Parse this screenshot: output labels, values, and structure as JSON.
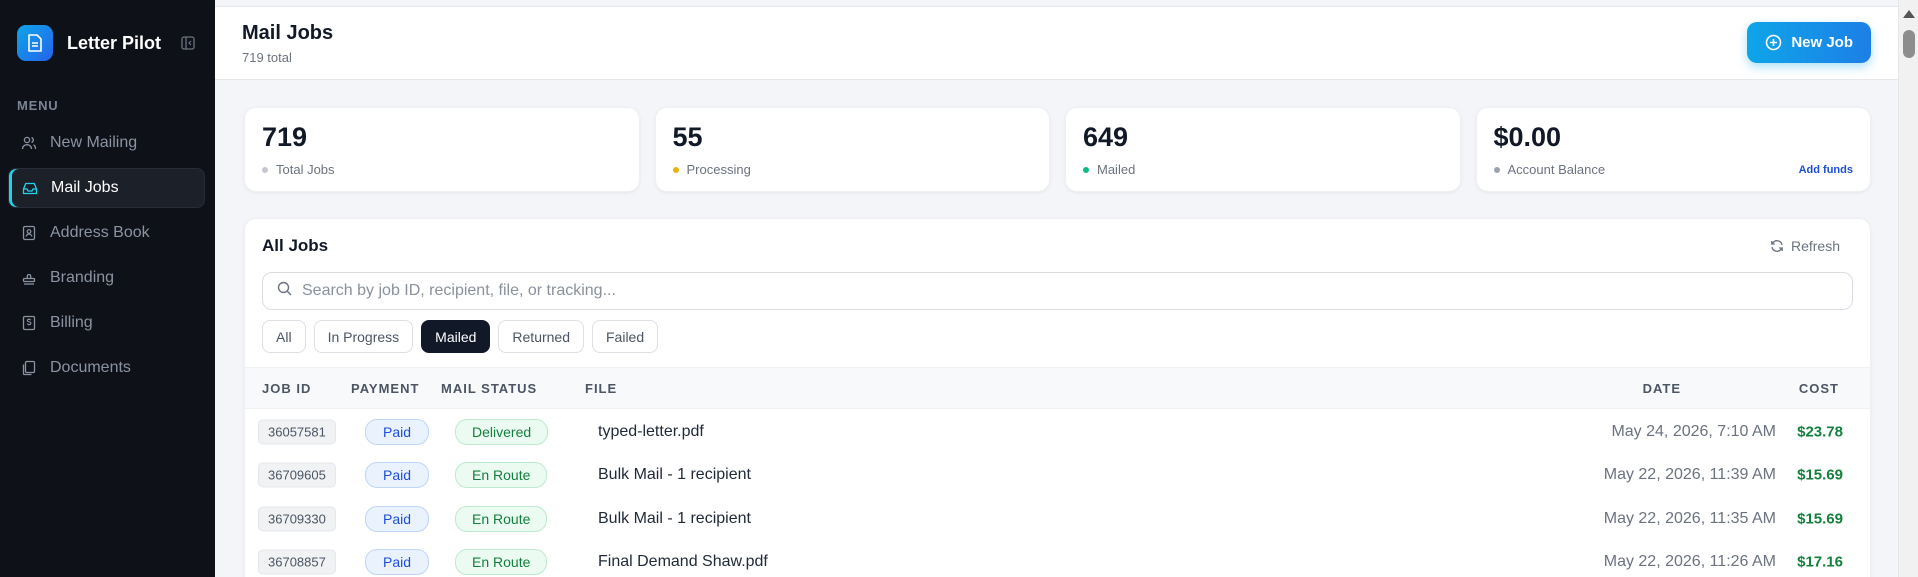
{
  "app": {
    "name": "Letter Pilot"
  },
  "sidebar": {
    "menu_label": "MENU",
    "items": [
      {
        "label": "New Mailing",
        "icon": "users-icon",
        "active": false
      },
      {
        "label": "Mail Jobs",
        "icon": "inbox-icon",
        "active": true
      },
      {
        "label": "Address Book",
        "icon": "contact-book-icon",
        "active": false
      },
      {
        "label": "Branding",
        "icon": "stamp-icon",
        "active": false
      },
      {
        "label": "Billing",
        "icon": "receipt-icon",
        "active": false
      },
      {
        "label": "Documents",
        "icon": "documents-icon",
        "active": false
      }
    ]
  },
  "header": {
    "title": "Mail Jobs",
    "subtitle": "719 total",
    "new_job_label": "New Job"
  },
  "stats": [
    {
      "value": "719",
      "label": "Total Jobs",
      "dot_color": "#c4c8ce"
    },
    {
      "value": "55",
      "label": "Processing",
      "dot_color": "#eab308"
    },
    {
      "value": "649",
      "label": "Mailed",
      "dot_color": "#10b981"
    },
    {
      "value": "$0.00",
      "label": "Account Balance",
      "dot_color": "#9ca3af",
      "action": "Add funds"
    }
  ],
  "jobs": {
    "title": "All Jobs",
    "refresh_label": "Refresh",
    "search_placeholder": "Search by job ID, recipient, file, or tracking...",
    "filters": [
      {
        "label": "All",
        "active": false
      },
      {
        "label": "In Progress",
        "active": false
      },
      {
        "label": "Mailed",
        "active": true
      },
      {
        "label": "Returned",
        "active": false
      },
      {
        "label": "Failed",
        "active": false
      }
    ],
    "columns": [
      "JOB ID",
      "PAYMENT",
      "MAIL STATUS",
      "FILE",
      "DATE",
      "COST"
    ],
    "rows": [
      {
        "job_id": "36057581",
        "payment": "Paid",
        "status": "Delivered",
        "file": "typed-letter.pdf",
        "date": "May 24, 2026, 7:10 AM",
        "cost": "$23.78"
      },
      {
        "job_id": "36709605",
        "payment": "Paid",
        "status": "En Route",
        "file": "Bulk Mail - 1 recipient",
        "date": "May 22, 2026, 11:39 AM",
        "cost": "$15.69"
      },
      {
        "job_id": "36709330",
        "payment": "Paid",
        "status": "En Route",
        "file": "Bulk Mail - 1 recipient",
        "date": "May 22, 2026, 11:35 AM",
        "cost": "$15.69"
      },
      {
        "job_id": "36708857",
        "payment": "Paid",
        "status": "En Route",
        "file": "Final Demand Shaw.pdf",
        "date": "May 22, 2026, 11:26 AM",
        "cost": "$17.16"
      }
    ]
  },
  "colors": {
    "accent": "#0ea5e9",
    "sidebar_bg": "#0e1117",
    "success": "#15803d",
    "payment": "#1d4ed8"
  }
}
